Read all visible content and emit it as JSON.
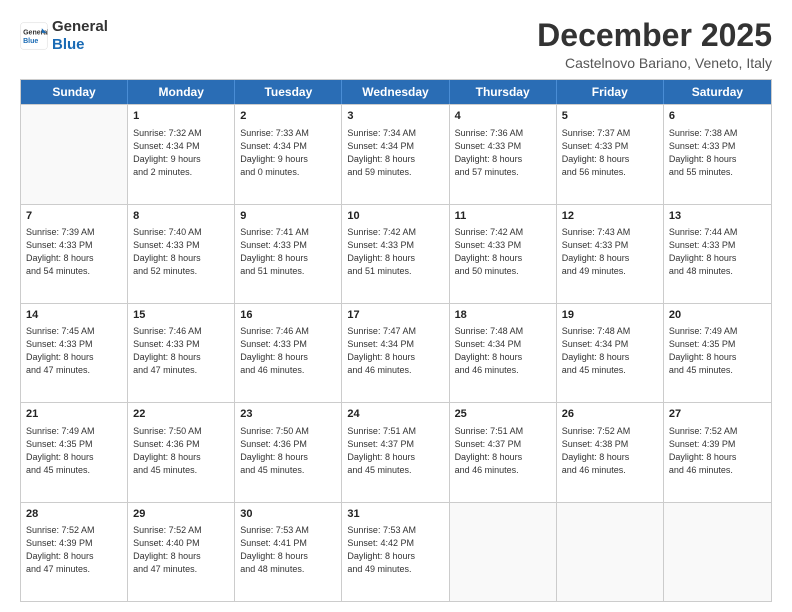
{
  "logo": {
    "line1": "General",
    "line2": "Blue"
  },
  "title": "December 2025",
  "location": "Castelnovo Bariano, Veneto, Italy",
  "days_header": [
    "Sunday",
    "Monday",
    "Tuesday",
    "Wednesday",
    "Thursday",
    "Friday",
    "Saturday"
  ],
  "weeks": [
    [
      {
        "day": "",
        "info": ""
      },
      {
        "day": "1",
        "info": "Sunrise: 7:32 AM\nSunset: 4:34 PM\nDaylight: 9 hours\nand 2 minutes."
      },
      {
        "day": "2",
        "info": "Sunrise: 7:33 AM\nSunset: 4:34 PM\nDaylight: 9 hours\nand 0 minutes."
      },
      {
        "day": "3",
        "info": "Sunrise: 7:34 AM\nSunset: 4:34 PM\nDaylight: 8 hours\nand 59 minutes."
      },
      {
        "day": "4",
        "info": "Sunrise: 7:36 AM\nSunset: 4:33 PM\nDaylight: 8 hours\nand 57 minutes."
      },
      {
        "day": "5",
        "info": "Sunrise: 7:37 AM\nSunset: 4:33 PM\nDaylight: 8 hours\nand 56 minutes."
      },
      {
        "day": "6",
        "info": "Sunrise: 7:38 AM\nSunset: 4:33 PM\nDaylight: 8 hours\nand 55 minutes."
      }
    ],
    [
      {
        "day": "7",
        "info": "Sunrise: 7:39 AM\nSunset: 4:33 PM\nDaylight: 8 hours\nand 54 minutes."
      },
      {
        "day": "8",
        "info": "Sunrise: 7:40 AM\nSunset: 4:33 PM\nDaylight: 8 hours\nand 52 minutes."
      },
      {
        "day": "9",
        "info": "Sunrise: 7:41 AM\nSunset: 4:33 PM\nDaylight: 8 hours\nand 51 minutes."
      },
      {
        "day": "10",
        "info": "Sunrise: 7:42 AM\nSunset: 4:33 PM\nDaylight: 8 hours\nand 51 minutes."
      },
      {
        "day": "11",
        "info": "Sunrise: 7:42 AM\nSunset: 4:33 PM\nDaylight: 8 hours\nand 50 minutes."
      },
      {
        "day": "12",
        "info": "Sunrise: 7:43 AM\nSunset: 4:33 PM\nDaylight: 8 hours\nand 49 minutes."
      },
      {
        "day": "13",
        "info": "Sunrise: 7:44 AM\nSunset: 4:33 PM\nDaylight: 8 hours\nand 48 minutes."
      }
    ],
    [
      {
        "day": "14",
        "info": "Sunrise: 7:45 AM\nSunset: 4:33 PM\nDaylight: 8 hours\nand 47 minutes."
      },
      {
        "day": "15",
        "info": "Sunrise: 7:46 AM\nSunset: 4:33 PM\nDaylight: 8 hours\nand 47 minutes."
      },
      {
        "day": "16",
        "info": "Sunrise: 7:46 AM\nSunset: 4:33 PM\nDaylight: 8 hours\nand 46 minutes."
      },
      {
        "day": "17",
        "info": "Sunrise: 7:47 AM\nSunset: 4:34 PM\nDaylight: 8 hours\nand 46 minutes."
      },
      {
        "day": "18",
        "info": "Sunrise: 7:48 AM\nSunset: 4:34 PM\nDaylight: 8 hours\nand 46 minutes."
      },
      {
        "day": "19",
        "info": "Sunrise: 7:48 AM\nSunset: 4:34 PM\nDaylight: 8 hours\nand 45 minutes."
      },
      {
        "day": "20",
        "info": "Sunrise: 7:49 AM\nSunset: 4:35 PM\nDaylight: 8 hours\nand 45 minutes."
      }
    ],
    [
      {
        "day": "21",
        "info": "Sunrise: 7:49 AM\nSunset: 4:35 PM\nDaylight: 8 hours\nand 45 minutes."
      },
      {
        "day": "22",
        "info": "Sunrise: 7:50 AM\nSunset: 4:36 PM\nDaylight: 8 hours\nand 45 minutes."
      },
      {
        "day": "23",
        "info": "Sunrise: 7:50 AM\nSunset: 4:36 PM\nDaylight: 8 hours\nand 45 minutes."
      },
      {
        "day": "24",
        "info": "Sunrise: 7:51 AM\nSunset: 4:37 PM\nDaylight: 8 hours\nand 45 minutes."
      },
      {
        "day": "25",
        "info": "Sunrise: 7:51 AM\nSunset: 4:37 PM\nDaylight: 8 hours\nand 46 minutes."
      },
      {
        "day": "26",
        "info": "Sunrise: 7:52 AM\nSunset: 4:38 PM\nDaylight: 8 hours\nand 46 minutes."
      },
      {
        "day": "27",
        "info": "Sunrise: 7:52 AM\nSunset: 4:39 PM\nDaylight: 8 hours\nand 46 minutes."
      }
    ],
    [
      {
        "day": "28",
        "info": "Sunrise: 7:52 AM\nSunset: 4:39 PM\nDaylight: 8 hours\nand 47 minutes."
      },
      {
        "day": "29",
        "info": "Sunrise: 7:52 AM\nSunset: 4:40 PM\nDaylight: 8 hours\nand 47 minutes."
      },
      {
        "day": "30",
        "info": "Sunrise: 7:53 AM\nSunset: 4:41 PM\nDaylight: 8 hours\nand 48 minutes."
      },
      {
        "day": "31",
        "info": "Sunrise: 7:53 AM\nSunset: 4:42 PM\nDaylight: 8 hours\nand 49 minutes."
      },
      {
        "day": "",
        "info": ""
      },
      {
        "day": "",
        "info": ""
      },
      {
        "day": "",
        "info": ""
      }
    ]
  ]
}
